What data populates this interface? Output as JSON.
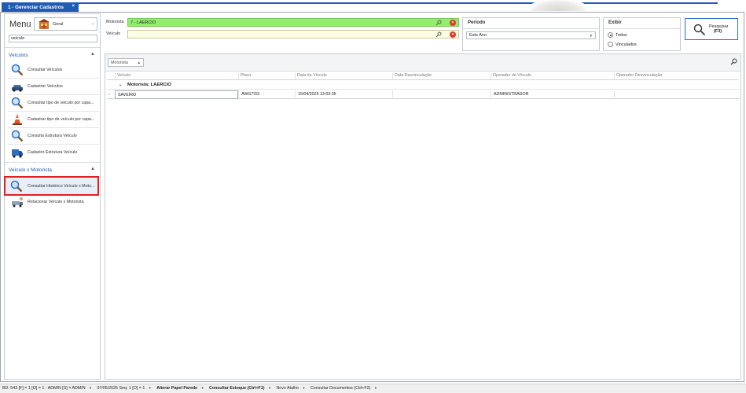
{
  "tab": {
    "title": "1 - Gerenciar Cadastros",
    "close": "×"
  },
  "sidebar": {
    "menu_title": "Menu",
    "profile": "Geral",
    "search_value": "veiculo",
    "groups": [
      {
        "title": "Veículos",
        "chevron": "▲",
        "items": [
          {
            "label": "Consultar Veículos",
            "icon": "search-icon"
          },
          {
            "label": "Cadastrar Veículos",
            "icon": "car-icon"
          },
          {
            "label": "Consultar tipo de veiculo por capa...",
            "icon": "search-icon"
          },
          {
            "label": "Cadastrar tipo de veículo por capa...",
            "icon": "cone-icon"
          },
          {
            "label": "Consulta Estrutura Veículo",
            "icon": "search-icon"
          },
          {
            "label": "Cadastro Estrutura Veículo",
            "icon": "truck-icon"
          }
        ]
      },
      {
        "title": "Veículo x Motorista",
        "chevron": "▲",
        "items": [
          {
            "label": "Consultar Histórico Veículo x Moto...",
            "icon": "search-icon",
            "selected": true
          },
          {
            "label": "Relacionar Veículo x Motorista",
            "icon": "truck-driver-icon"
          }
        ]
      }
    ]
  },
  "filters": {
    "motorista_label": "Motorista",
    "motorista_value": "7 - LAERCIO",
    "veiculo_label": "Veículo",
    "veiculo_value": ""
  },
  "periodo": {
    "title": "Período",
    "selected": "Este Ano"
  },
  "exibir": {
    "title": "Exibir",
    "options": [
      "Todos",
      "Vinculados"
    ],
    "selected": "Todos"
  },
  "pesquisar": {
    "label": "Pesquisar",
    "shortcut": "(F3)"
  },
  "grid": {
    "groupby_chip": "Motorista",
    "columns": [
      "Veículo",
      "Placa",
      "Data do Vínculo",
      "Data Desvinculação",
      "Operador do Vínculo",
      "Operador Desvinculação"
    ],
    "group_label": "Motorista: LAERCIO",
    "rows": [
      {
        "veiculo": "SAVEIRO",
        "placa": "AWG7I33",
        "data_vinculo": "15/04/2025 13:03:35",
        "data_desvinculacao": "",
        "operador_vinculo": "ADMINISTRADOR",
        "operador_desvinculacao": ""
      }
    ]
  },
  "statusbar": {
    "info": "BD: 543  [F] = 1  [O] = 1 - ADMIN [S] = ADMIN",
    "date_seq": "07/05/2025 Seq: 1  [O] = 1",
    "links": [
      "Alterar Papel Parede",
      "Consultar Estoque (Ctrl+F1)",
      "Novo Atalho",
      "Consultar Documentos (Ctrl+F2)"
    ]
  }
}
